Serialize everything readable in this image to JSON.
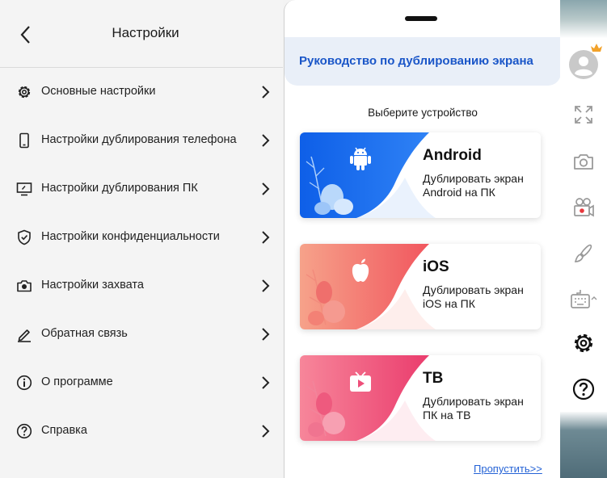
{
  "settings": {
    "title": "Настройки",
    "items": [
      {
        "label": "Основные настройки",
        "icon": "gear-icon"
      },
      {
        "label": "Настройки дублирования телефона",
        "icon": "phone-icon"
      },
      {
        "label": "Настройки дублирования ПК",
        "icon": "monitor-icon"
      },
      {
        "label": "Настройки конфиденциальности",
        "icon": "shield-icon"
      },
      {
        "label": "Настройки захвата",
        "icon": "camera-icon"
      },
      {
        "label": "Обратная связь",
        "icon": "pen-icon"
      },
      {
        "label": "О программе",
        "icon": "info-icon"
      },
      {
        "label": "Справка",
        "icon": "help-icon"
      }
    ]
  },
  "guide": {
    "title": "Руководство по дублированию экрана",
    "select_label": "Выберите устройство",
    "cards": [
      {
        "title": "Android",
        "desc": "Дублировать экран Android на ПК",
        "icon": "android-icon",
        "accent": "#1565e6"
      },
      {
        "title": "iOS",
        "desc": "Дублировать экран iOS на ПК",
        "icon": "apple-icon",
        "accent": "#f2706a"
      },
      {
        "title": "ТВ",
        "desc": "Дублировать экран ПК на ТВ",
        "icon": "tv-icon",
        "accent": "#ee4f7a"
      }
    ],
    "skip_label": "Пропустить>>"
  },
  "toolbar": {
    "buttons": [
      "avatar-icon",
      "fullscreen-icon",
      "screenshot-camera-icon",
      "record-icon",
      "brush-icon",
      "keyboard-icon",
      "settings-gear-icon",
      "help-icon"
    ]
  },
  "colors": {
    "accent_blue": "#1a56c8",
    "link_blue": "#2563d6",
    "header_bg": "#e9eff8"
  }
}
